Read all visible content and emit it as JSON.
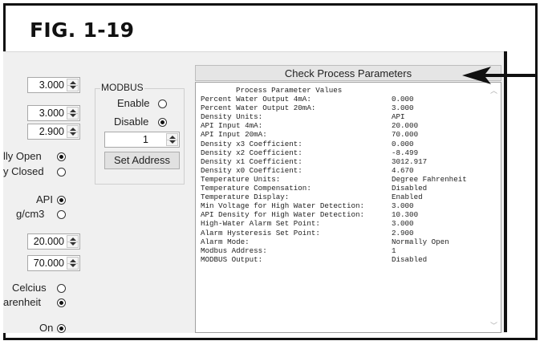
{
  "figure": {
    "title": "FIG. 1-19"
  },
  "left": {
    "spin1": "3.000",
    "spin2": "3.000",
    "spin3": "2.900",
    "alarm_mode": [
      {
        "label": "lly Open",
        "selected": true
      },
      {
        "label": "y Closed",
        "selected": false
      }
    ],
    "density_units": [
      {
        "label": "API",
        "selected": true
      },
      {
        "label": "g/cm3",
        "selected": false
      }
    ],
    "api_4ma": "20.000",
    "api_20ma": "70.000",
    "temp_units": [
      {
        "label": "Celcius",
        "selected": false
      },
      {
        "label": "arenheit",
        "selected": true
      }
    ],
    "temp_display": {
      "label": "On",
      "selected": true
    }
  },
  "modbus": {
    "group_label": "MODBUS",
    "enable_label": "Enable",
    "disable_label": "Disable",
    "address_value": "1",
    "set_address_label": "Set Address"
  },
  "check_button": {
    "label": "Check Process Parameters"
  },
  "console": {
    "header": "Process Parameter Values",
    "rows": [
      {
        "k": "Percent Water Output 4mA:",
        "v": "0.000"
      },
      {
        "k": "Percent Water Output 20mA:",
        "v": "3.000"
      },
      {
        "k": "Density Units:",
        "v": "API"
      },
      {
        "k": "API Input 4mA:",
        "v": "20.000"
      },
      {
        "k": "API Input 20mA:",
        "v": "70.000"
      },
      {
        "k": "Density x3 Coefficient:",
        "v": "0.000"
      },
      {
        "k": "Density x2 Coefficient:",
        "v": "-8.499"
      },
      {
        "k": "Density x1 Coefficient:",
        "v": "3012.917"
      },
      {
        "k": "Density x0 Coefficient:",
        "v": "4.670"
      },
      {
        "k": "Temperature Units:",
        "v": "Degree Fahrenheit"
      },
      {
        "k": "Temperature Compensation:",
        "v": "Disabled"
      },
      {
        "k": "Temperature Display:",
        "v": "Enabled"
      },
      {
        "k": "Min Voltage for High Water Detection:",
        "v": "3.000"
      },
      {
        "k": "API Density for High Water Detection:",
        "v": "10.300"
      },
      {
        "k": "High-Water Alarm Set Point:",
        "v": "3.000"
      },
      {
        "k": "Alarm Hysteresis Set Point:",
        "v": "2.900"
      },
      {
        "k": "Alarm Mode:",
        "v": "Normally Open"
      },
      {
        "k": "Modbus Address:",
        "v": "1"
      },
      {
        "k": "MODBUS Output:",
        "v": "Disabled"
      }
    ]
  },
  "icons": {
    "callout": "arrow-left-icon",
    "scroll_up": "chevron-up-icon",
    "scroll_down": "chevron-down-icon"
  }
}
